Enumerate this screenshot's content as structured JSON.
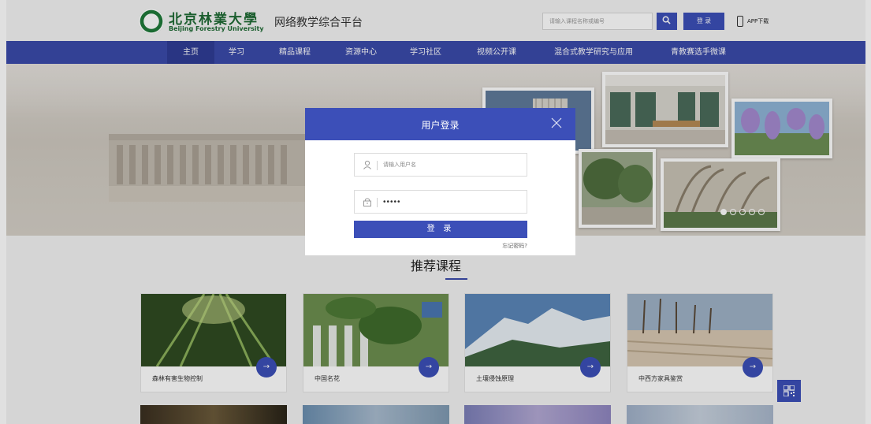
{
  "header": {
    "school_name_cn": "北京林業大學",
    "school_name_en": "Beijing Forestry University",
    "platform_name": "网络教学综合平台",
    "search_placeholder": "请输入课程名称或编号",
    "login_label": "登 录",
    "app_download_label": "APP下载"
  },
  "nav": {
    "items": [
      {
        "label": "主页",
        "active": true
      },
      {
        "label": "学习"
      },
      {
        "label": "精品课程"
      },
      {
        "label": "资源中心"
      },
      {
        "label": "学习社区"
      },
      {
        "label": "视频公开课"
      },
      {
        "label": "混合式教学研究与应用"
      },
      {
        "label": "青教赛选手微课"
      }
    ]
  },
  "banner": {
    "slide_count": 5,
    "active_slide": 1
  },
  "section": {
    "title": "推荐课程"
  },
  "courses": [
    {
      "title": "森林有害生物控制",
      "image": "bamboo-forest"
    },
    {
      "title": "中国名花",
      "image": "green-leaves-fence"
    },
    {
      "title": "土壤侵蚀原理",
      "image": "snow-mountain"
    },
    {
      "title": "中西方家具鉴赏",
      "image": "winter-trees"
    }
  ],
  "login_modal": {
    "title": "用户登录",
    "username_placeholder": "请输入用户名",
    "password_value": "•••••",
    "submit_label": "登 录",
    "forgot_label": "忘记密码?"
  },
  "colors": {
    "primary": "#3c4fb8",
    "nav_bg": "#3b4aaa",
    "brand_green": "#1f6b35"
  },
  "icons": [
    "search-icon",
    "phone-icon",
    "user-icon",
    "lock-icon",
    "close-icon",
    "arrow-right-icon",
    "qr-code-icon"
  ]
}
